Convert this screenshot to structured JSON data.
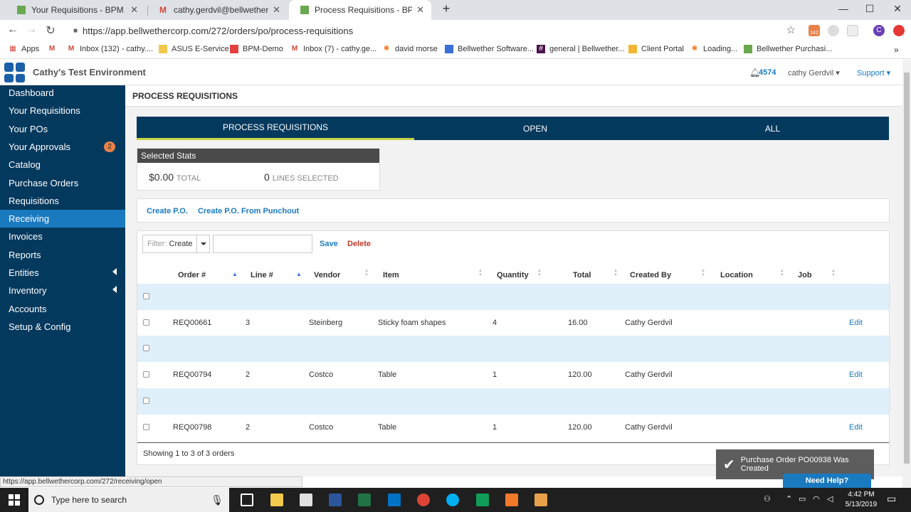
{
  "browser": {
    "tabs": [
      {
        "title": "Your Requisitions - BPM",
        "active": false
      },
      {
        "title": "cathy.gerdvil@bellwethercorp.co",
        "active": false
      },
      {
        "title": "Process Requisitions - BPM",
        "active": true
      }
    ],
    "new_tab": "+",
    "controls": {
      "minimize": "—",
      "maximize": "☐",
      "close": "✕"
    },
    "url": "https://app.bellwethercorp.com/272/orders/po/process-requisitions",
    "ext_badge": "142",
    "profile": "C",
    "bookmarks": [
      {
        "label": "Apps",
        "icon": "apps-grid-icon",
        "color": "#d14836"
      },
      {
        "label": "",
        "icon": "gmail-icon",
        "color": "#d14836"
      },
      {
        "label": "Inbox (132) - cathy....",
        "icon": "gmail-icon",
        "color": "#d14836"
      },
      {
        "label": "ASUS E-Service",
        "icon": "folder-icon",
        "color": "#f2c94c"
      },
      {
        "label": "BPM-Demo",
        "icon": "bpm-icon",
        "color": "#e04040"
      },
      {
        "label": "Inbox (7) - cathy.ge...",
        "icon": "gmail-icon",
        "color": "#d14836"
      },
      {
        "label": "david morse",
        "icon": "hubspot-icon",
        "color": "#f2782a"
      },
      {
        "label": "Bellwether Software...",
        "icon": "calendar-icon",
        "color": "#3a6fd8"
      },
      {
        "label": "general | Bellwether...",
        "icon": "slack-icon",
        "color": "#4a154b"
      },
      {
        "label": "Client Portal",
        "icon": "chat-icon",
        "color": "#f2b632"
      },
      {
        "label": "Loading...",
        "icon": "hubspot-icon",
        "color": "#f2782a"
      },
      {
        "label": "Bellwether Purchasi...",
        "icon": "bpm-icon",
        "color": "#6aa84f"
      }
    ],
    "status_url": "https://app.bellwethercorp.com/272/receiving/open"
  },
  "app": {
    "environment": "Cathy's Test Environment",
    "notifications": "4574",
    "user": "cathy Gerdvil",
    "support": "Support"
  },
  "sidebar": {
    "items": [
      {
        "label": "Dashboard"
      },
      {
        "label": "Your Requisitions"
      },
      {
        "label": "Your POs"
      },
      {
        "label": "Your Approvals",
        "badge": "2"
      },
      {
        "label": "Catalog"
      },
      {
        "label": "Purchase Orders"
      },
      {
        "label": "Requisitions"
      },
      {
        "label": "Receiving",
        "highlight": true
      },
      {
        "label": "Invoices"
      },
      {
        "label": "Reports"
      },
      {
        "label": "Entities",
        "caret": true
      },
      {
        "label": "Inventory",
        "caret": true
      },
      {
        "label": "Accounts"
      },
      {
        "label": "Setup & Config"
      }
    ]
  },
  "page": {
    "title": "PROCESS REQUISITIONS",
    "tabs": [
      {
        "label": "PROCESS REQUISITIONS",
        "active": true
      },
      {
        "label": "OPEN"
      },
      {
        "label": "ALL"
      }
    ],
    "stats": {
      "header": "Selected Stats",
      "total_value": "$0.00",
      "total_label": "TOTAL",
      "lines_value": "0",
      "lines_label": "LINES SELECTED"
    },
    "actions": {
      "create_po": "Create P.O.",
      "create_po_punchout": "Create P.O. From Punchout"
    },
    "filter": {
      "label": "Filter:",
      "value": "Create",
      "input_value": "",
      "save": "Save",
      "delete": "Delete"
    },
    "columns": [
      "Order #",
      "Line #",
      "Vendor",
      "Item",
      "Quantity",
      "Total",
      "Created By",
      "Location",
      "Job"
    ],
    "rows": [
      {
        "order": "REQ00661",
        "line": "3",
        "vendor": "Steinberg",
        "item": "Sticky foam shapes",
        "quantity": "4",
        "total": "16.00",
        "created_by": "Cathy Gerdvil",
        "location": "",
        "job": "",
        "edit": "Edit"
      },
      {
        "order": "REQ00794",
        "line": "2",
        "vendor": "Costco",
        "item": "Table",
        "quantity": "1",
        "total": "120.00",
        "created_by": "Cathy Gerdvil",
        "location": "",
        "job": "",
        "edit": "Edit"
      },
      {
        "order": "REQ00798",
        "line": "2",
        "vendor": "Costco",
        "item": "Table",
        "quantity": "1",
        "total": "120.00",
        "created_by": "Cathy Gerdvil",
        "location": "",
        "job": "",
        "edit": "Edit"
      }
    ],
    "showing": "Showing 1 to 3 of 3 orders",
    "toast": "Purchase Order PO00938 Was Created",
    "need_help": "Need Help?"
  },
  "taskbar": {
    "search_placeholder": "Type here to search",
    "time": "4:42 PM",
    "date": "5/13/2019"
  }
}
